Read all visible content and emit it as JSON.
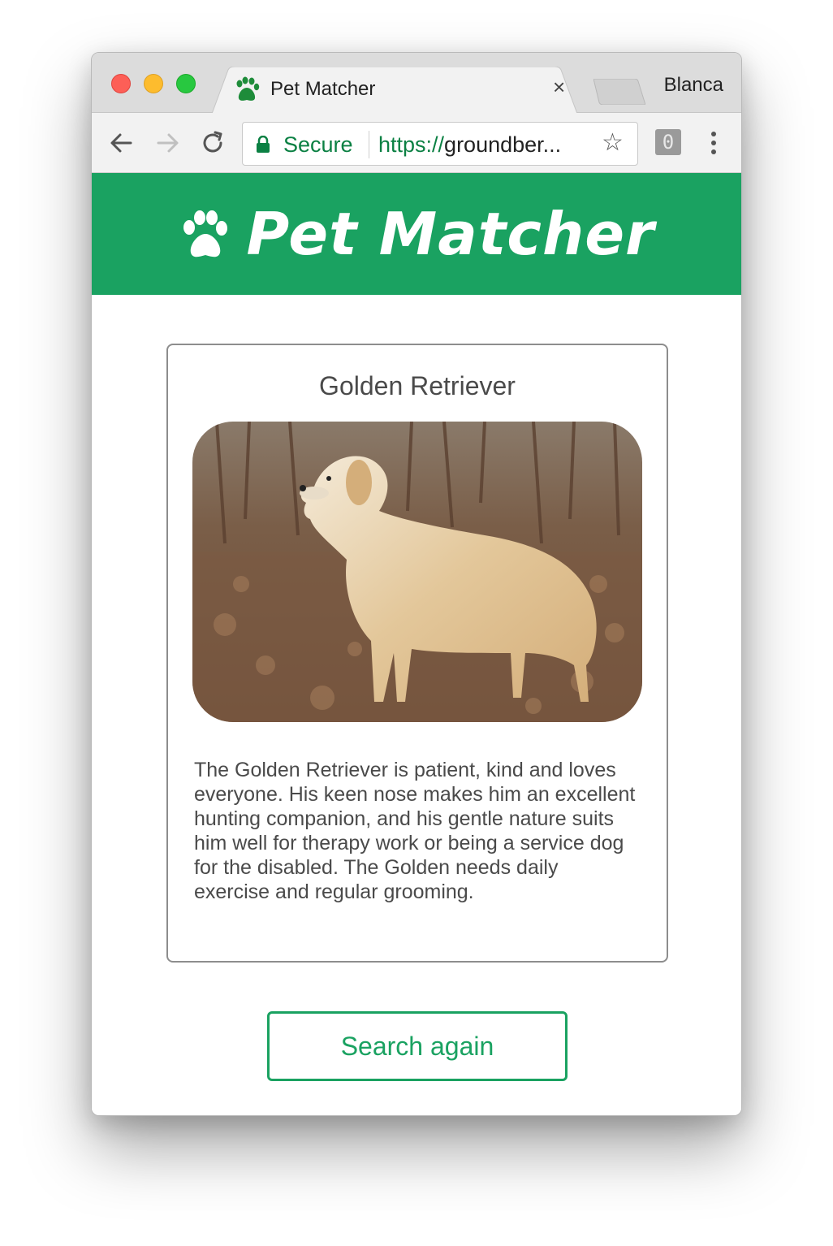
{
  "browser": {
    "tab_title": "Pet Matcher",
    "tab_close": "×",
    "profile_name": "Blanca",
    "security_label": "Secure",
    "url_scheme": "https://",
    "url_rest": "groundber...",
    "extension_badge": "0",
    "accent_secure": "#0b8043"
  },
  "header": {
    "title": "Pet Matcher",
    "icon": "paw-icon",
    "background_color": "#1aa261"
  },
  "result": {
    "breed": "Golden Retriever",
    "image_alt": "golden retriever standing in autumn leaves",
    "description": "The Golden Retriever is patient, kind and loves everyone. His keen nose makes him an excellent hunting companion, and his gentle nature suits him well for therapy work or being a service dog for the disabled. The Golden needs daily exercise and regular grooming."
  },
  "actions": {
    "search_again_label": "Search again"
  }
}
